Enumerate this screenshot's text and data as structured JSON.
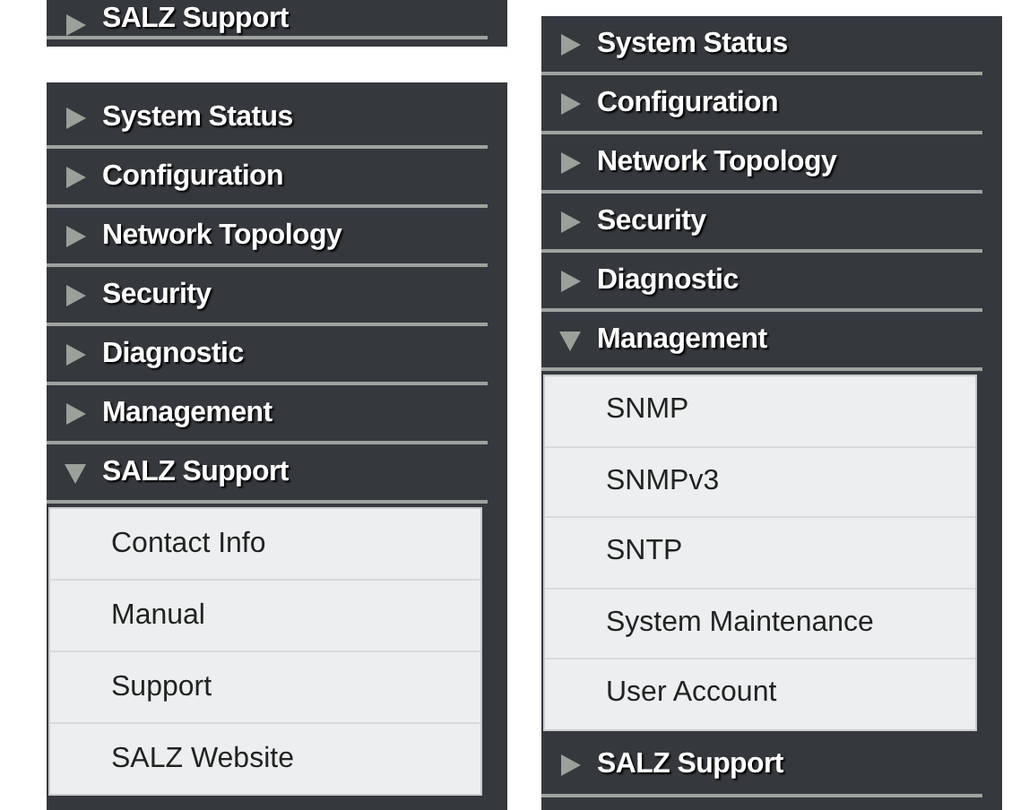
{
  "panels": [
    {
      "items": [
        {
          "label": "SALZ Support",
          "expanded": false
        }
      ]
    },
    {
      "items": [
        {
          "label": "System Status",
          "expanded": false
        },
        {
          "label": "Configuration",
          "expanded": false
        },
        {
          "label": "Network Topology",
          "expanded": false
        },
        {
          "label": "Security",
          "expanded": false
        },
        {
          "label": "Diagnostic",
          "expanded": false
        },
        {
          "label": "Management",
          "expanded": false
        },
        {
          "label": "SALZ Support",
          "expanded": true,
          "children": [
            {
              "label": "Contact Info"
            },
            {
              "label": "Manual"
            },
            {
              "label": "Support"
            },
            {
              "label": "SALZ Website"
            }
          ]
        }
      ]
    },
    {
      "items": [
        {
          "label": "System Status",
          "expanded": false
        },
        {
          "label": "Configuration",
          "expanded": false
        },
        {
          "label": "Network Topology",
          "expanded": false
        },
        {
          "label": "Security",
          "expanded": false
        },
        {
          "label": "Diagnostic",
          "expanded": false
        },
        {
          "label": "Management",
          "expanded": true,
          "children": [
            {
              "label": "SNMP"
            },
            {
              "label": "SNMPv3"
            },
            {
              "label": "SNTP"
            },
            {
              "label": "System Maintenance"
            },
            {
              "label": "User Account"
            }
          ]
        },
        {
          "label": "SALZ Support",
          "expanded": false
        }
      ]
    }
  ]
}
